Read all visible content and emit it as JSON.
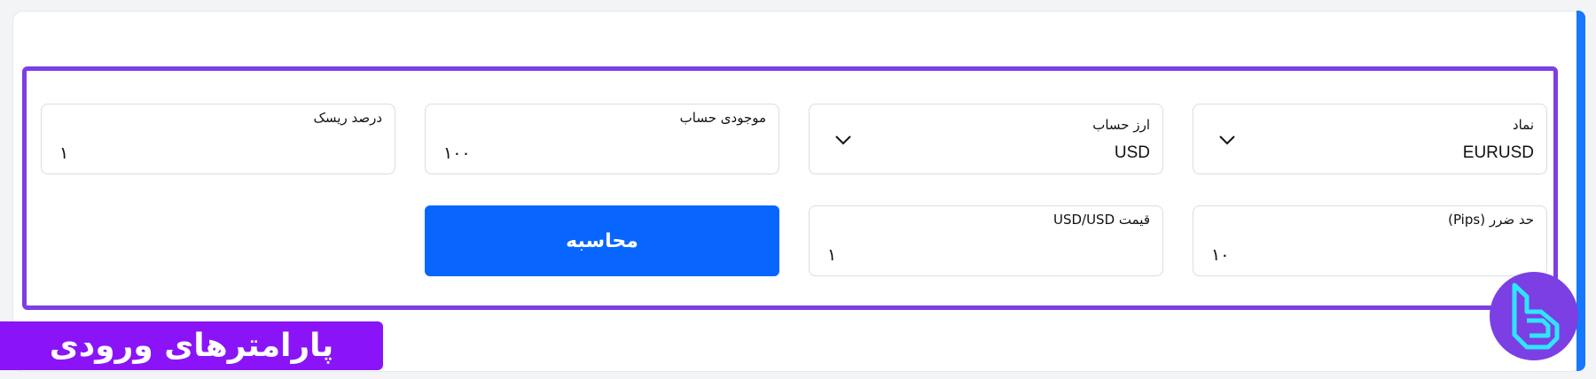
{
  "form": {
    "symbol": {
      "label": "نماد",
      "value": "EURUSD"
    },
    "account_currency": {
      "label": "ارز حساب",
      "value": "USD"
    },
    "account_balance": {
      "label": "موجودی حساب",
      "value": "۱۰۰"
    },
    "risk_percent": {
      "label": "درصد ریسک",
      "value": "۱"
    },
    "stop_loss": {
      "label": "حد ضرر (Pips)",
      "value": "۱۰"
    },
    "price": {
      "label": "قیمت USD/USD",
      "value": "۱"
    },
    "calculate_label": "محاسبه"
  },
  "banner": {
    "text": "پارامترهای ورودی"
  },
  "icons": {
    "select_chevron": "chevron-down-icon",
    "logo": "brand-logo-icon"
  },
  "colors": {
    "accent": "#7b3fe4",
    "button": "#0866ff",
    "banner": "#8a14f7",
    "stripe": "#1677ff"
  }
}
